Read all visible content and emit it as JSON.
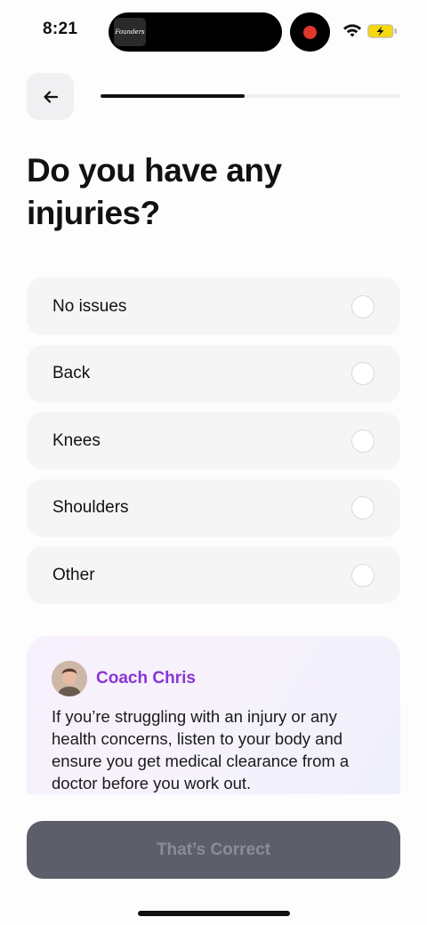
{
  "status_bar": {
    "time": "8:21",
    "island_thumb_text": "Founders",
    "recording_color": "#e0362c"
  },
  "header": {
    "back_icon": "arrow-left-icon",
    "progress": 0.48
  },
  "question": {
    "title": "Do you have any injuries?"
  },
  "options": [
    {
      "label": "No issues",
      "selected": false
    },
    {
      "label": "Back",
      "selected": false
    },
    {
      "label": "Knees",
      "selected": false
    },
    {
      "label": "Shoulders",
      "selected": false
    },
    {
      "label": "Other",
      "selected": false
    }
  ],
  "coach": {
    "name": "Coach Chris",
    "name_color": "#8a35d4",
    "message": "If you’re struggling with an injury or any health concerns, listen to your body and ensure you get medical clearance from a doctor before you work out."
  },
  "cta": {
    "label": "That’s Correct",
    "enabled": false
  }
}
